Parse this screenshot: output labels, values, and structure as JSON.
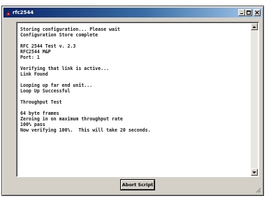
{
  "window": {
    "title": "rfc2544",
    "minimize_icon": "minimize-icon",
    "maximize_icon": "maximize-icon",
    "close_icon": "close-icon"
  },
  "console": {
    "lines": [
      "Storing configuration... Please wait",
      "Configuration Store complete",
      "",
      "RFC 2544 Test v. 2.3",
      "RFC2544 M&P",
      "Port: 1",
      "",
      "Verifying that link is active...",
      "Link Found",
      "",
      "Looping up far end unit...",
      "Loop Up Successful",
      "",
      "Throughput Test",
      "",
      "64 byte frames",
      "Zeroing in on maximum throughput rate",
      "100% pass",
      "Now verifying 100%.  This will take 20 seconds."
    ]
  },
  "buttons": {
    "abort_label": "Abort Script"
  },
  "colors": {
    "title_gradient_start": "#0a246a",
    "title_gradient_end": "#a6caf0",
    "window_face": "#d4d0c8"
  }
}
